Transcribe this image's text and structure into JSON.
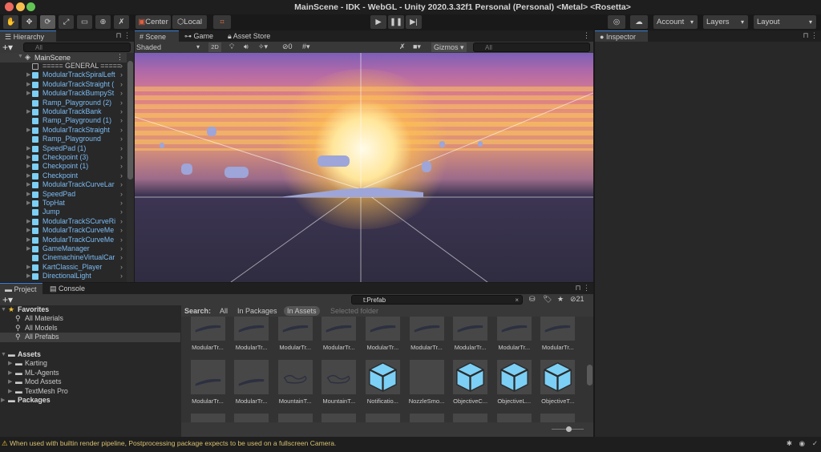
{
  "window": {
    "title": "MainScene - IDK - WebGL - Unity 2020.3.32f1 Personal (Personal) <Metal> <Rosetta>"
  },
  "toolbar": {
    "center": "Center",
    "local": "Local",
    "account": "Account",
    "layers": "Layers",
    "layout": "Layout",
    "tools": [
      "hand-tool",
      "move-tool",
      "rotate-tool",
      "scale-tool",
      "rect-tool",
      "transform-tool",
      "custom-tool"
    ]
  },
  "hierarchy": {
    "tab": "Hierarchy",
    "search_placeholder": "All",
    "scene": "MainScene",
    "items": [
      {
        "label": "===== GENERAL =====",
        "type": "empty",
        "expand": false
      },
      {
        "label": "ModularTrackSpiralLeft",
        "expand": true
      },
      {
        "label": "ModularTrackStraight (",
        "expand": true
      },
      {
        "label": "ModularTrackBumpySt",
        "expand": true
      },
      {
        "label": "Ramp_Playground (2)",
        "expand": false
      },
      {
        "label": "ModularTrackBank",
        "expand": true
      },
      {
        "label": "Ramp_Playground (1)",
        "expand": false
      },
      {
        "label": "ModularTrackStraight",
        "expand": true
      },
      {
        "label": "Ramp_Playground",
        "expand": false
      },
      {
        "label": "SpeedPad (1)",
        "expand": true
      },
      {
        "label": "Checkpoint (3)",
        "expand": true
      },
      {
        "label": "Checkpoint (1)",
        "expand": true
      },
      {
        "label": "Checkpoint",
        "expand": true
      },
      {
        "label": "ModularTrackCurveLar",
        "expand": true
      },
      {
        "label": "SpeedPad",
        "expand": true
      },
      {
        "label": "TopHat",
        "expand": true
      },
      {
        "label": "Jump",
        "expand": false
      },
      {
        "label": "ModularTrackSCurveRi",
        "expand": true
      },
      {
        "label": "ModularTrackCurveMe",
        "expand": true
      },
      {
        "label": "ModularTrackCurveMe",
        "expand": true
      },
      {
        "label": "GameManager",
        "expand": true
      },
      {
        "label": "CinemachineVirtualCar",
        "expand": false
      },
      {
        "label": "KartClassic_Player",
        "expand": true
      },
      {
        "label": "DirectionalLight",
        "expand": true
      }
    ]
  },
  "scene": {
    "tabs": [
      "Scene",
      "Game",
      "Asset Store"
    ],
    "shading": "Shaded",
    "mode2d": "2D",
    "hidden_count": "0",
    "gizmos": "Gizmos",
    "search_placeholder": "All"
  },
  "inspector": {
    "tab": "Inspector"
  },
  "project": {
    "tabs": [
      "Project",
      "Console"
    ],
    "favorites": {
      "label": "Favorites",
      "items": [
        "All Materials",
        "All Models",
        "All Prefabs"
      ]
    },
    "assets": {
      "label": "Assets",
      "items": [
        "Karting",
        "ML-Agents",
        "Mod Assets",
        "TextMesh Pro"
      ]
    },
    "packages": "Packages",
    "search_value": "t:Prefab",
    "hidden_count": "21",
    "search_scope": {
      "label": "Search:",
      "options": [
        "All",
        "In Packages",
        "In Assets",
        "Selected folder"
      ],
      "selected": "In Assets"
    },
    "grid": [
      {
        "label": "ModularTr...",
        "kind": "track"
      },
      {
        "label": "ModularTr...",
        "kind": "track"
      },
      {
        "label": "ModularTr...",
        "kind": "track"
      },
      {
        "label": "ModularTr...",
        "kind": "track"
      },
      {
        "label": "ModularTr...",
        "kind": "track"
      },
      {
        "label": "ModularTr...",
        "kind": "track"
      },
      {
        "label": "ModularTr...",
        "kind": "track"
      },
      {
        "label": "ModularTr...",
        "kind": "track"
      },
      {
        "label": "ModularTr...",
        "kind": "track"
      },
      {
        "label": "ModularTr...",
        "kind": "track"
      },
      {
        "label": "ModularTr...",
        "kind": "track"
      },
      {
        "label": "MountainT...",
        "kind": "outline"
      },
      {
        "label": "MountainT...",
        "kind": "outline"
      },
      {
        "label": "Notificatio...",
        "kind": "prefab"
      },
      {
        "label": "NozzleSmo...",
        "kind": "empty"
      },
      {
        "label": "ObjectiveC...",
        "kind": "prefab"
      },
      {
        "label": "ObjectiveL...",
        "kind": "prefab"
      },
      {
        "label": "ObjectiveT...",
        "kind": "prefab"
      }
    ]
  },
  "status": {
    "message": "When used with builtin render pipeline, Postprocessing package expects to be used on a fullscreen Camera."
  },
  "colors": {
    "accent": "#3a7fd5",
    "prefab": "#7ccff5",
    "warning": "#f2c12e"
  }
}
